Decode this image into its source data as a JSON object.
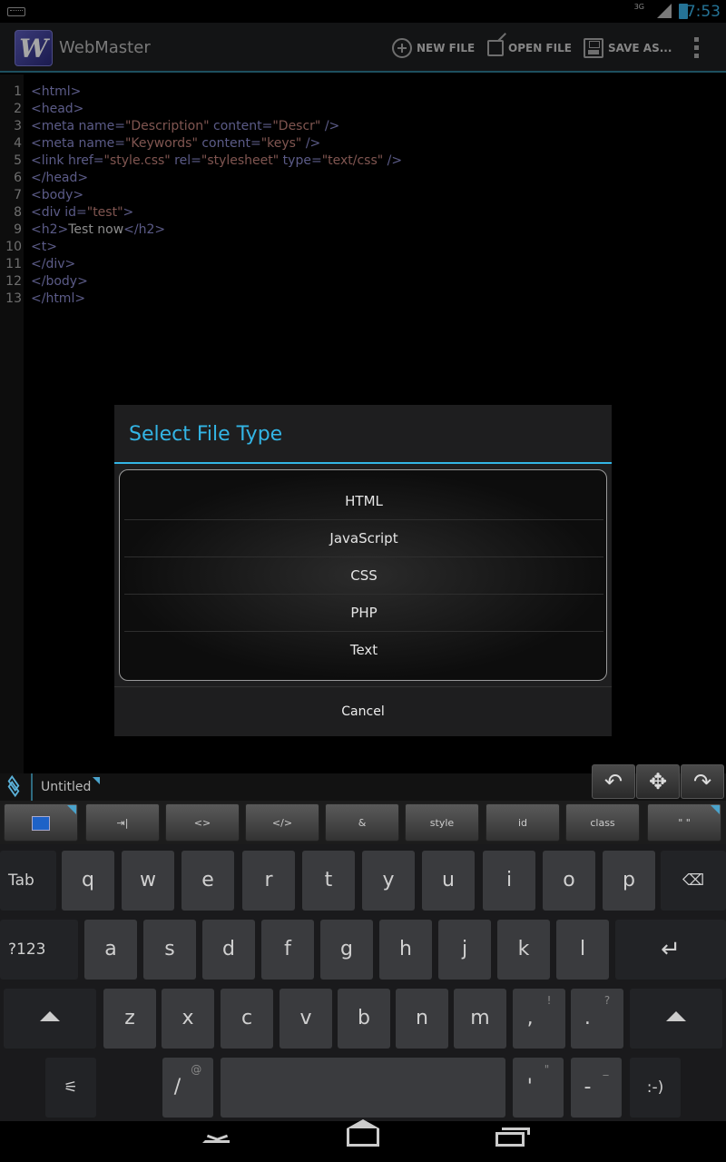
{
  "status": {
    "network": "3G",
    "time": "7:53"
  },
  "app": {
    "title": "WebMaster",
    "icon_letter": "W"
  },
  "actions": {
    "new_file": "NEW FILE",
    "open_file": "OPEN FILE",
    "save_as": "SAVE AS..."
  },
  "editor": {
    "line_numbers": [
      "1",
      "2",
      "3",
      "4",
      "5",
      "6",
      "7",
      "8",
      "9",
      "10",
      "11",
      "12",
      "13"
    ]
  },
  "dialog": {
    "title": "Select File Type",
    "options": [
      "HTML",
      "JavaScript",
      "CSS",
      "PHP",
      "Text"
    ],
    "cancel": "Cancel"
  },
  "file_tab": {
    "name": "Untitled"
  },
  "snippets": [
    "⇥|",
    "<>",
    "</>",
    "&",
    "style",
    "id",
    "class",
    "\" \""
  ],
  "keyboard": {
    "row1": [
      "Tab",
      "q",
      "w",
      "e",
      "r",
      "t",
      "y",
      "u",
      "i",
      "o",
      "p"
    ],
    "row2": [
      "?123",
      "a",
      "s",
      "d",
      "f",
      "g",
      "h",
      "j",
      "k",
      "l"
    ],
    "row3": [
      "z",
      "x",
      "c",
      "v",
      "b",
      "n",
      "m",
      ",",
      "."
    ],
    "row3_hints": [
      "!",
      "?"
    ],
    "row4": [
      "/",
      "'",
      "-",
      ":-)"
    ],
    "row4_hints": [
      "@",
      "\"",
      "_"
    ]
  },
  "colors": {
    "accent": "#33b5e5",
    "tag": "#8c8cd0",
    "string": "#c4837c"
  }
}
